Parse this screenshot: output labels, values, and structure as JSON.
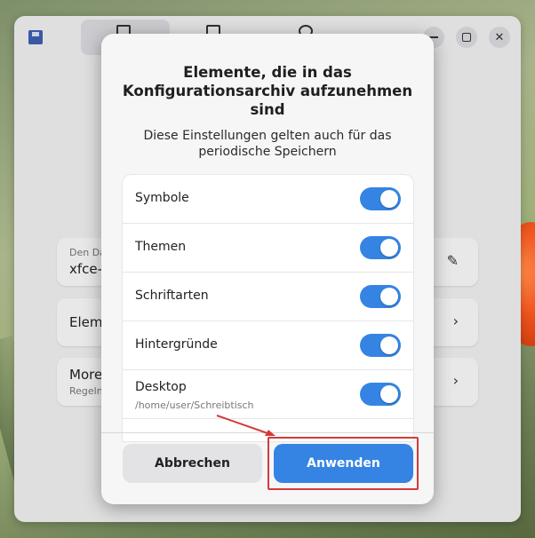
{
  "background_rows": [
    {
      "sub": "Den Da",
      "main": "xfce-",
      "trail_icon": "pencil-icon"
    },
    {
      "main": "Eleme",
      "trail_icon": "chevron-right-icon"
    },
    {
      "main": "More",
      "sub": "Regeln",
      "trail_icon": "chevron-right-icon"
    }
  ],
  "dialog": {
    "title": "Elemente, die in das Konfigurationsarchiv aufzunehmen sind",
    "subtitle": "Diese Einstellungen gelten auch für das periodische Speichern",
    "items": [
      {
        "label": "Symbole",
        "enabled": true
      },
      {
        "label": "Themen",
        "enabled": true
      },
      {
        "label": "Schriftarten",
        "enabled": true
      },
      {
        "label": "Hintergründe",
        "enabled": true
      },
      {
        "label": "Desktop",
        "path": "/home/user/Schreibtisch",
        "enabled": true
      }
    ],
    "cancel_label": "Abbrechen",
    "apply_label": "Anwenden"
  },
  "colors": {
    "accent": "#3584e4",
    "highlight": "#d23b3b"
  }
}
